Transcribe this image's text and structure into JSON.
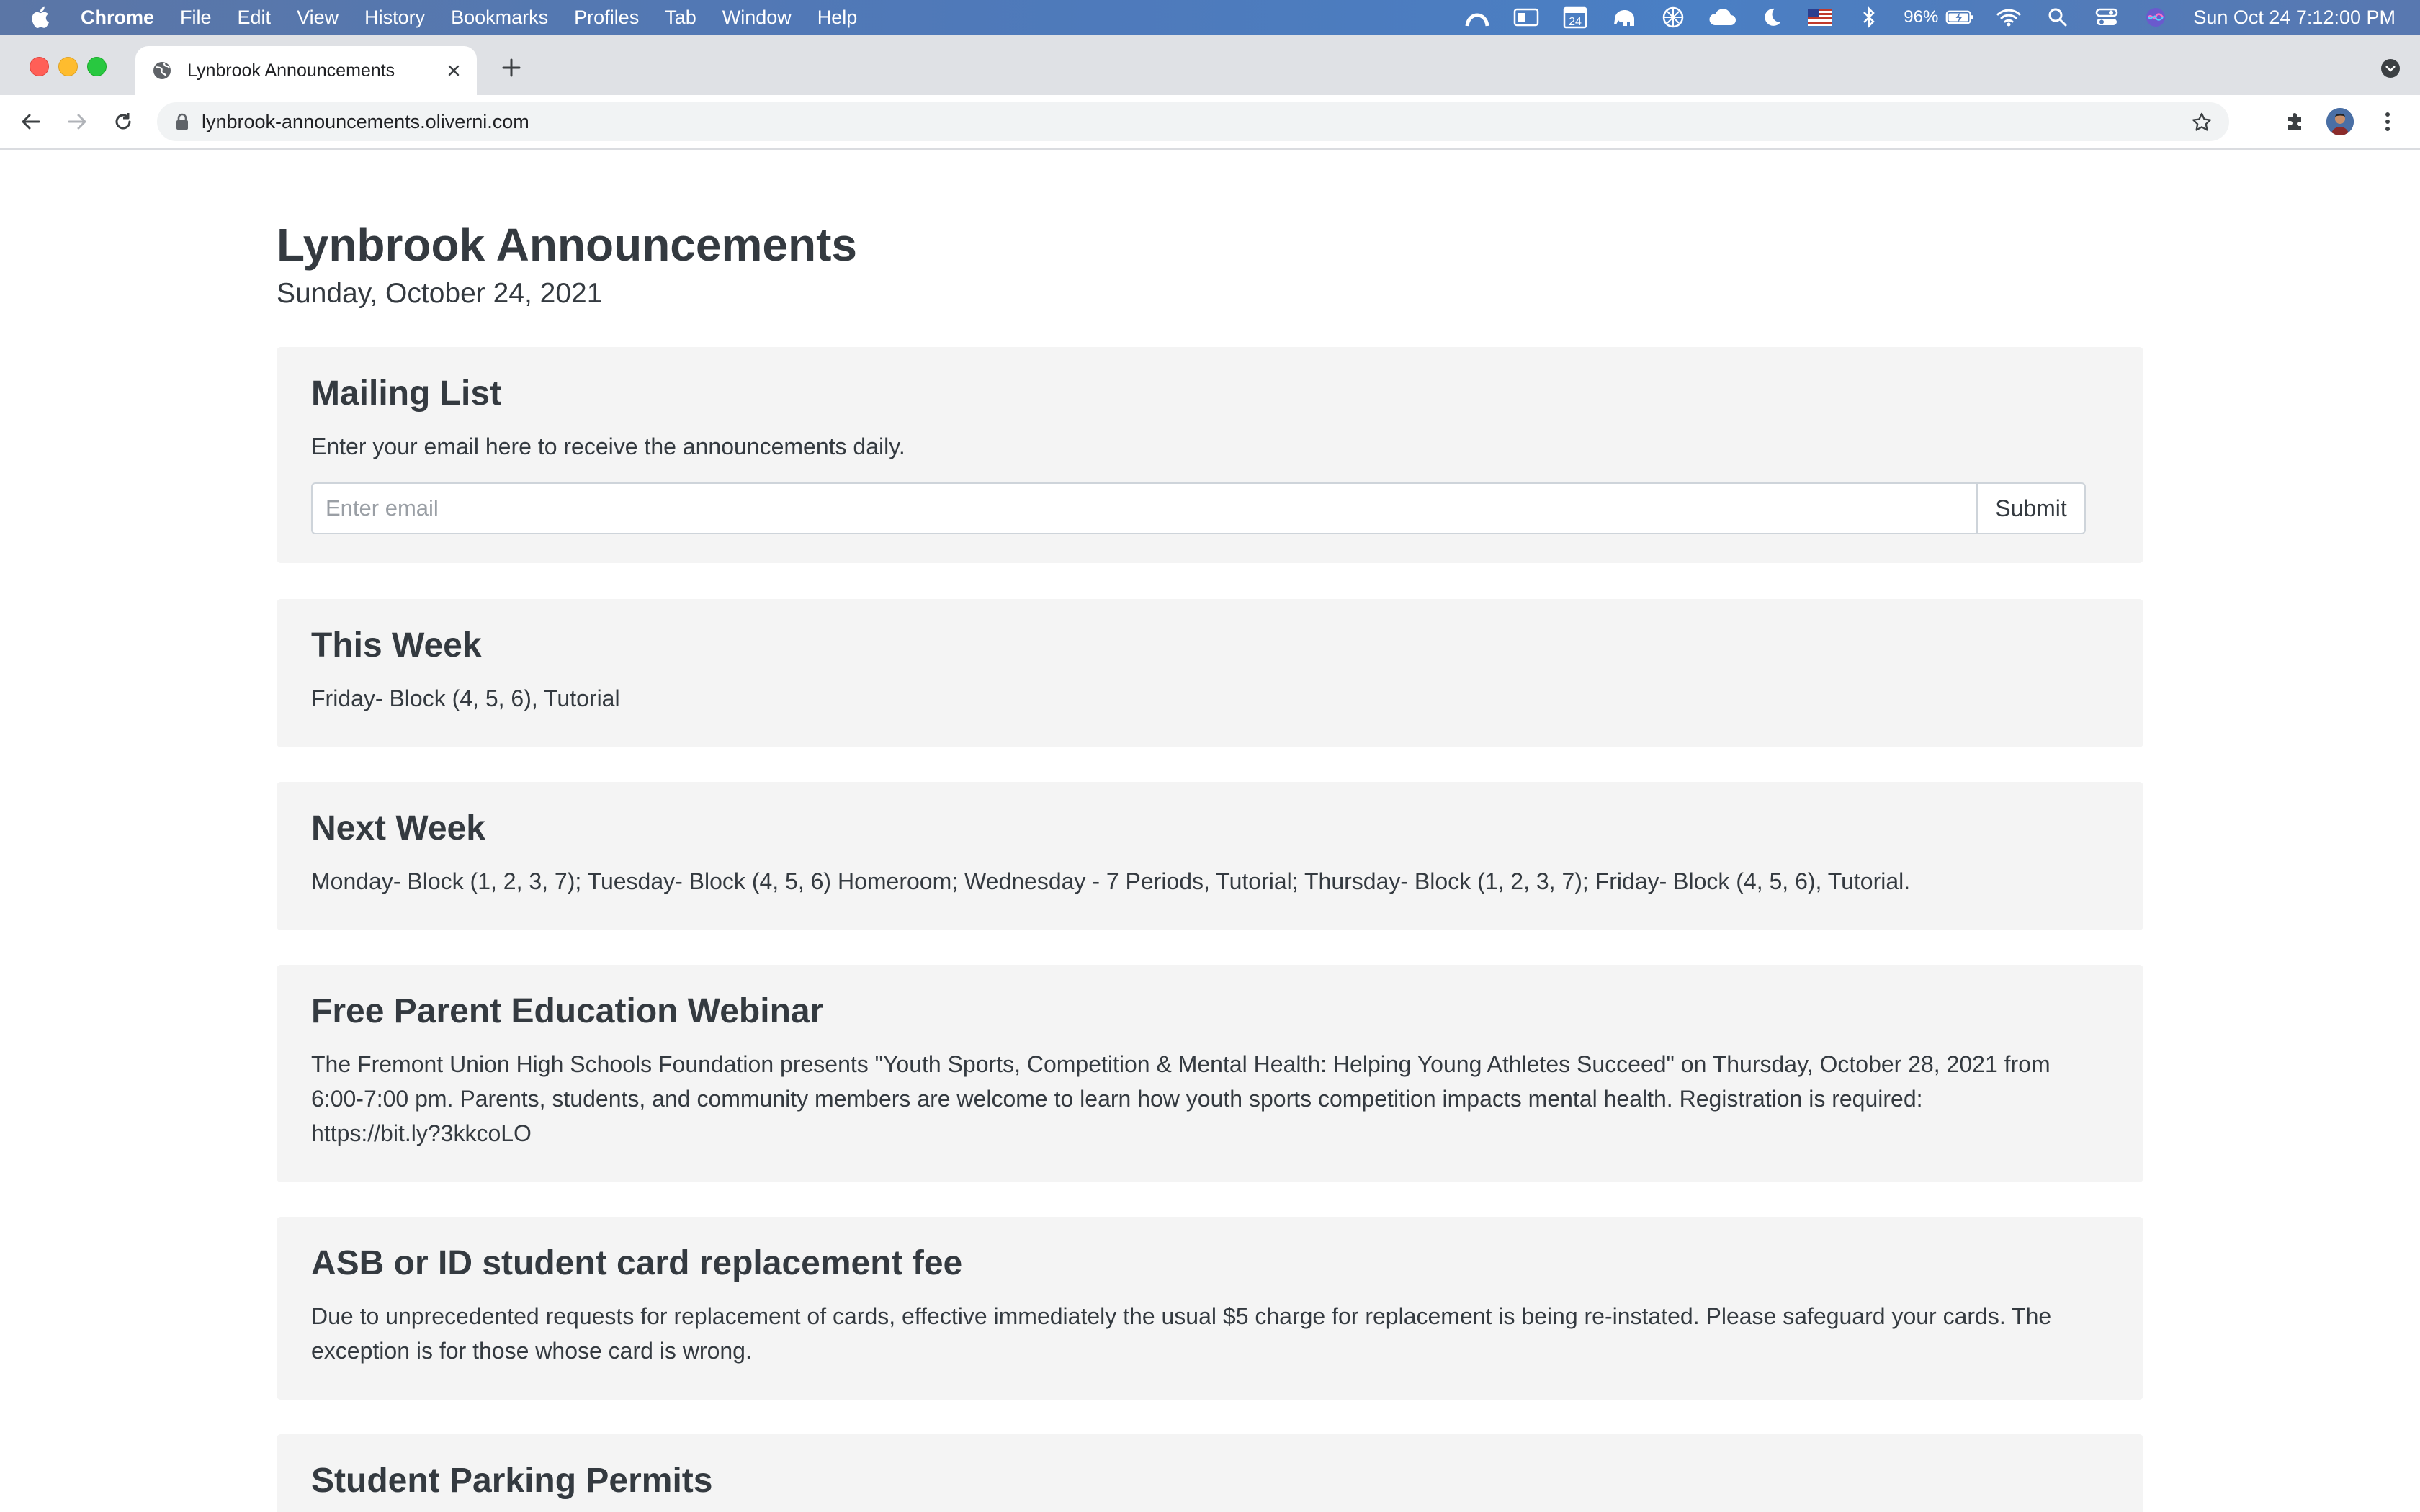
{
  "menubar": {
    "app_name": "Chrome",
    "items": [
      "File",
      "Edit",
      "View",
      "History",
      "Bookmarks",
      "Profiles",
      "Tab",
      "Window",
      "Help"
    ],
    "battery": "96%",
    "clock": "Sun Oct 24  7:12:00 PM",
    "calendar_day": "24"
  },
  "browser": {
    "tab_title": "Lynbrook Announcements",
    "url": "lynbrook-announcements.oliverni.com"
  },
  "page": {
    "title": "Lynbrook Announcements",
    "date": "Sunday, October 24, 2021",
    "mailing_list": {
      "heading": "Mailing List",
      "description": "Enter your email here to receive the announcements daily.",
      "email_placeholder": "Enter email",
      "submit_label": "Submit"
    },
    "announcements": [
      {
        "heading": "This Week",
        "body": "Friday- Block (4, 5, 6), Tutorial"
      },
      {
        "heading": "Next Week",
        "body": "Monday- Block (1, 2, 3, 7); Tuesday- Block (4, 5, 6) Homeroom; Wednesday - 7 Periods, Tutorial; Thursday- Block (1, 2, 3, 7); Friday- Block (4, 5, 6), Tutorial."
      },
      {
        "heading": "Free Parent Education Webinar",
        "body": "The Fremont Union High Schools Foundation presents \"Youth Sports, Competition & Mental Health: Helping Young Athletes Succeed\" on Thursday, October 28, 2021 from 6:00-7:00 pm. Parents, students, and community members are welcome to learn how youth sports competition impacts mental health. Registration is required: https://bit.ly?3kkcoLO"
      },
      {
        "heading": "ASB or ID student card replacement fee",
        "body": "Due to unprecedented requests for replacement of cards, effective immediately the usual $5 charge for replacement is being re-instated. Please safeguard your cards. The exception is for those whose card is wrong."
      },
      {
        "heading": "Student Parking Permits"
      }
    ]
  }
}
